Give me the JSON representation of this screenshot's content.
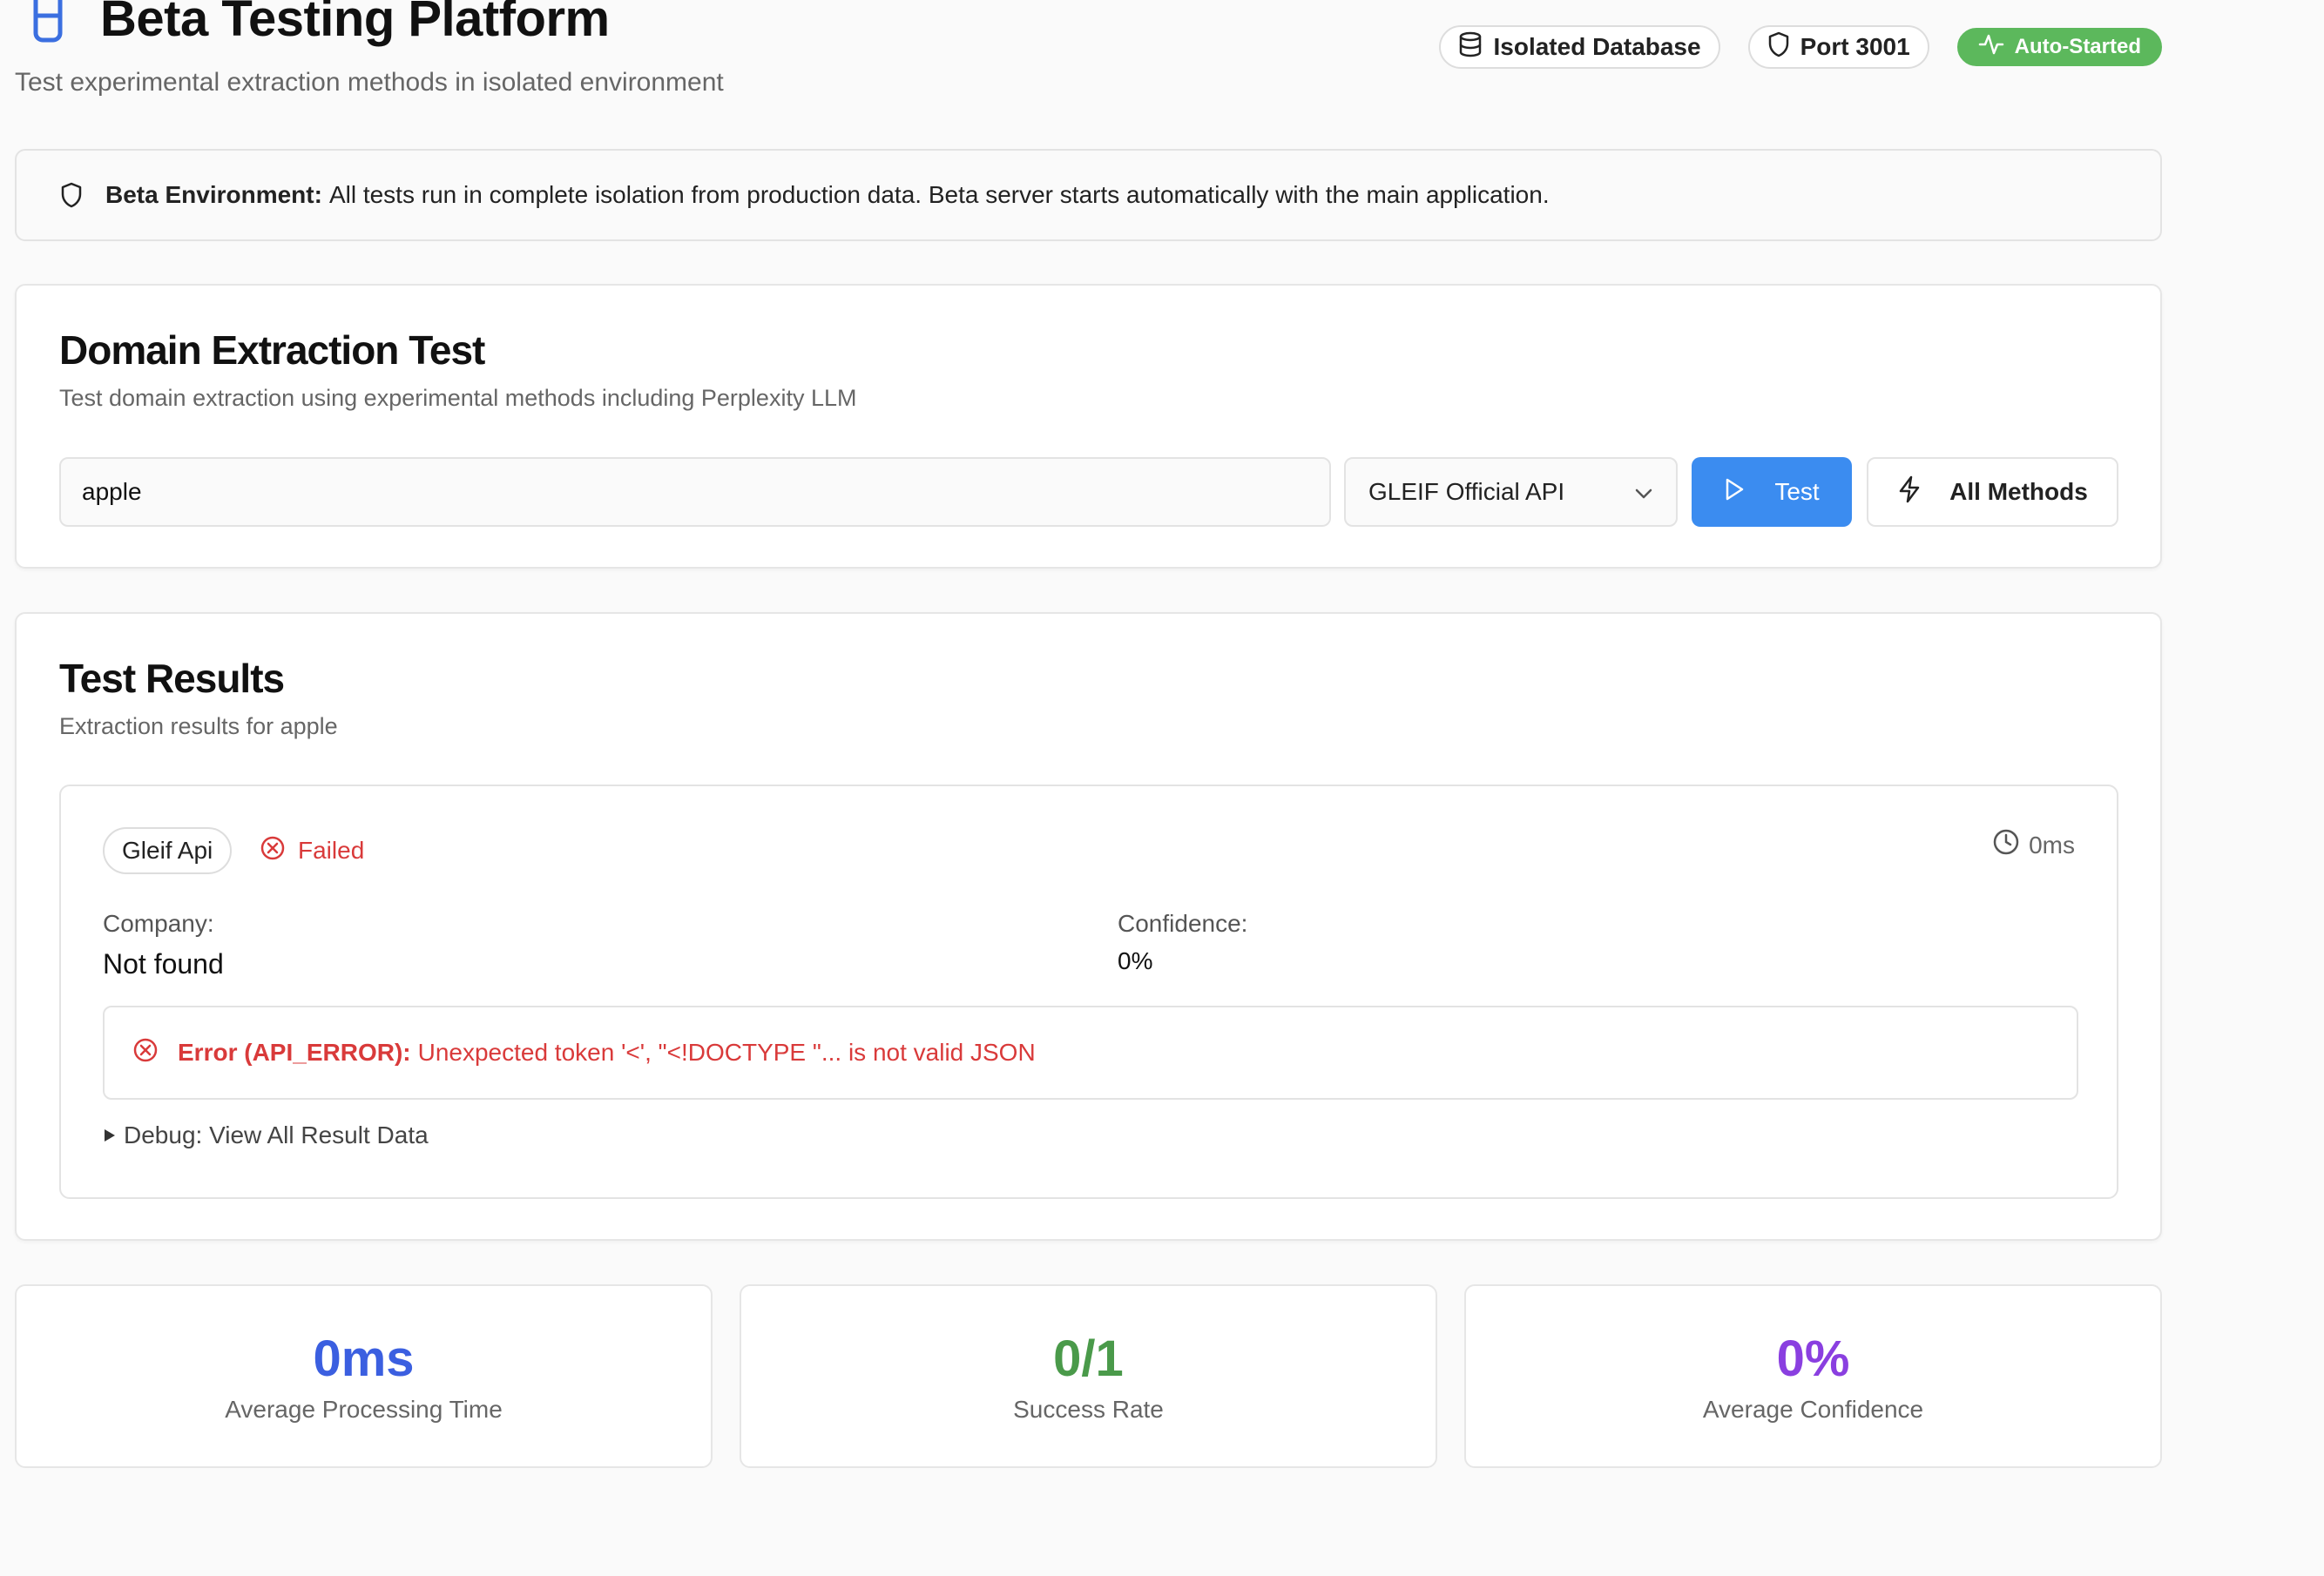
{
  "header": {
    "title": "Beta Testing Platform",
    "subtitle": "Test experimental extraction methods in isolated environment",
    "badges": {
      "database": "Isolated Database",
      "port": "Port 3001",
      "status": "Auto-Started"
    }
  },
  "banner": {
    "label": "Beta Environment:",
    "text": "All tests run in complete isolation from production data. Beta server starts automatically with the main application."
  },
  "extraction": {
    "title": "Domain Extraction Test",
    "description": "Test domain extraction using experimental methods including Perplexity LLM",
    "input_value": "apple",
    "method_selected": "GLEIF Official API",
    "test_label": "Test",
    "all_methods_label": "All Methods"
  },
  "results": {
    "title": "Test Results",
    "description": "Extraction results for apple",
    "item": {
      "method": "Gleif Api",
      "status": "Failed",
      "time": "0ms",
      "company_label": "Company:",
      "company_value": "Not found",
      "confidence_label": "Confidence:",
      "confidence_value": "0%",
      "error_label": "Error (API_ERROR):",
      "error_message": "Unexpected token '<', \"<!DOCTYPE \"... is not valid JSON",
      "debug_label": "Debug: View All Result Data"
    }
  },
  "stats": [
    {
      "value": "0ms",
      "label": "Average Processing Time",
      "color": "#3b5fe0"
    },
    {
      "value": "0/1",
      "label": "Success Rate",
      "color": "#4a9a4a"
    },
    {
      "value": "0%",
      "label": "Average Confidence",
      "color": "#8a3fe0"
    }
  ],
  "colors": {
    "primary": "#3b8cf0",
    "success_badge": "#5cb85c",
    "error": "#d93a3a",
    "title_icon": "#3b6fe0"
  }
}
